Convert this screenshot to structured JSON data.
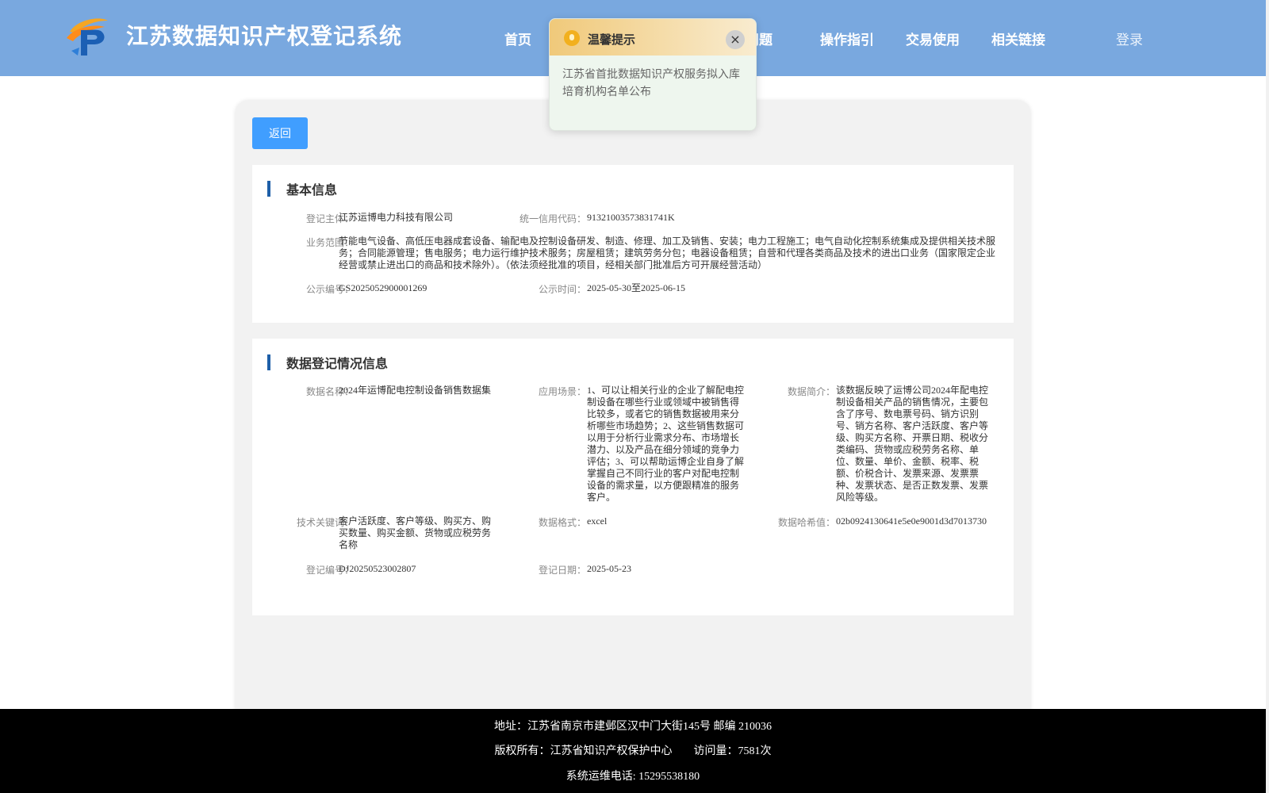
{
  "header": {
    "title": "江苏数据知识产权登记系统",
    "nav": [
      "首页",
      "常见问题",
      "操作指引",
      "交易使用",
      "相关链接"
    ],
    "login": "登录"
  },
  "back_label": "返回",
  "basic": {
    "title": "基本信息",
    "subject_label": "登记主体：",
    "subject": "江苏运博电力科技有限公司",
    "credit_label": "统一信用代码：",
    "credit": "91321003573831741K",
    "scope_label": "业务范围：",
    "scope": "节能电气设备、高低压电器成套设备、输配电及控制设备研发、制造、修理、加工及销售、安装；电力工程施工；电气自动化控制系统集成及提供相关技术服务；合同能源管理；售电服务；电力运行维护技术服务；房屋租赁；建筑劳务分包；电器设备租赁；自营和代理各类商品及技术的进出口业务（国家限定企业经营或禁止进出口的商品和技术除外）。（依法须经批准的项目，经相关部门批准后方可开展经营活动）",
    "pub_no_label": "公示编号：",
    "pub_no": "GS2025052900001269",
    "pub_time_label": "公示时间：",
    "pub_time": "2025-05-30至2025-06-15"
  },
  "registration": {
    "title": "数据登记情况信息",
    "name_label": "数据名称：",
    "name": "2024年运博配电控制设备销售数据集",
    "scene_label": "应用场景：",
    "scene": "1、可以让相关行业的企业了解配电控制设备在哪些行业或领域中被销售得比较多，或者它的销售数据被用来分析哪些市场趋势；2、这些销售数据可以用于分析行业需求分布、市场增长潜力、以及产品在细分领域的竞争力评估；3、可以帮助运博企业自身了解掌握自己不同行业的客户对配电控制设备的需求量，以方便跟精准的服务客户。",
    "intro_label": "数据简介：",
    "intro": "该数据反映了运博公司2024年配电控制设备相关产品的销售情况，主要包含了序号、数电票号码、销方识别号、销方名称、客户活跃度、客户等级、购买方名称、开票日期、税收分类编码、货物或应税劳务名称、单位、数量、单价、金额、税率、税额、价税合计、发票来源、发票票种、发票状态、是否正数发票、发票风险等级。",
    "keywords_label": "技术关键词：",
    "keywords": "客户活跃度、客户等级、购买方、购买数量、购买金额、货物或应税劳务名称",
    "format_label": "数据格式：",
    "format": "excel",
    "hash_label": "数据哈希值：",
    "hash": "02b0924130641e5e0e9001d3d7013730",
    "reg_no_label": "登记编号：",
    "reg_no": "DJ20250523002807",
    "reg_date_label": "登记日期：",
    "reg_date": "2025-05-23"
  },
  "popup": {
    "title": "温馨提示",
    "close": "×",
    "body": "江苏省首批数据知识产权服务拟入库培育机构名单公布"
  },
  "footer": {
    "address": "地址：江苏省南京市建邺区汉中门大街145号 邮编 210036",
    "copyright": "版权所有：江苏省知识产权保护中心",
    "visits": "访问量：7581次",
    "phone": "系统运维电话: 15295538180"
  }
}
